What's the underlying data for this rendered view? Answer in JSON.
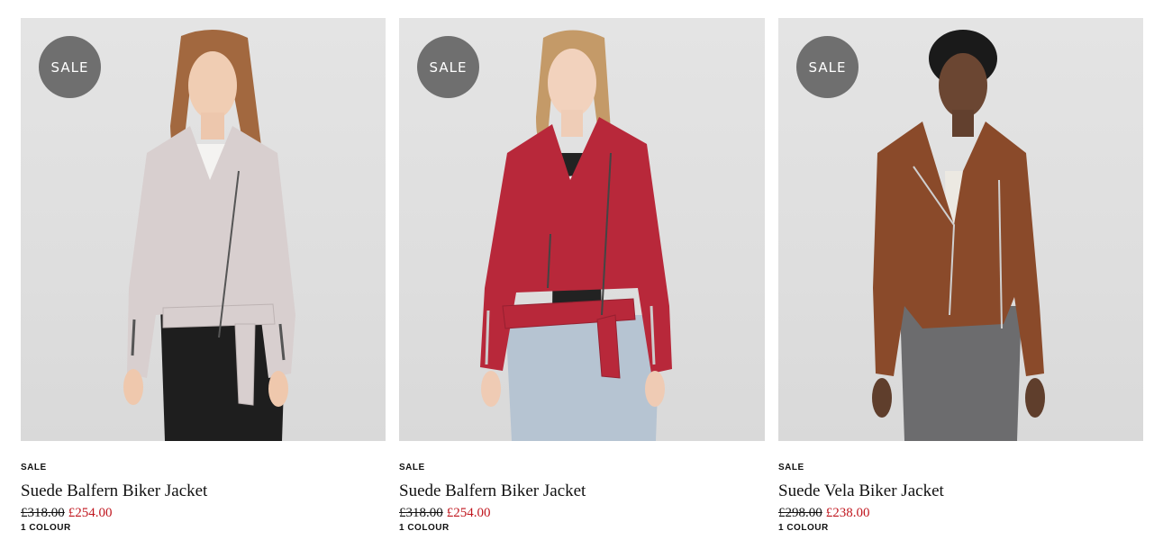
{
  "products": [
    {
      "badge": "SALE",
      "tag": "SALE",
      "name": "Suede Balfern Biker Jacket",
      "was_price": "£318.00",
      "now_price": "£254.00",
      "colours": "1 COLOUR",
      "jacket_color": "#d8cfcf",
      "pants_color": "#1e1e1e"
    },
    {
      "badge": "SALE",
      "tag": "SALE",
      "name": "Suede Balfern Biker Jacket",
      "was_price": "£318.00",
      "now_price": "£254.00",
      "colours": "1 COLOUR",
      "jacket_color": "#b8283a",
      "pants_color": "#b6c4d2"
    },
    {
      "badge": "SALE",
      "tag": "SALE",
      "name": "Suede Vela Biker Jacket",
      "was_price": "£298.00",
      "now_price": "£238.00",
      "colours": "1 COLOUR",
      "jacket_color": "#8a4a2a",
      "pants_color": "#6c6c6e"
    }
  ],
  "colors": {
    "sale_price": "#c0161e",
    "badge_bg": "#6f6f6f"
  }
}
